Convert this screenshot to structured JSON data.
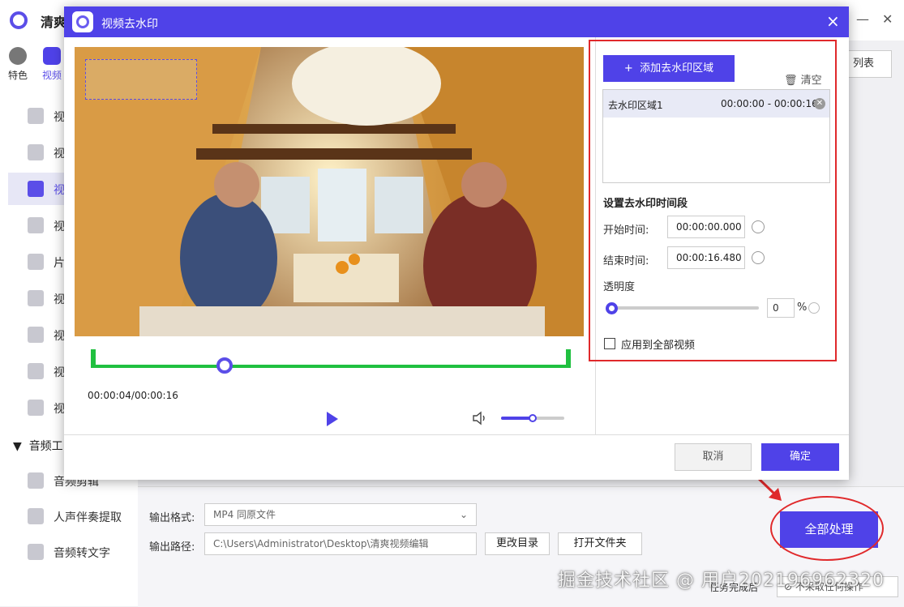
{
  "app": {
    "title": "清爽",
    "top_nav": [
      {
        "label": "特色"
      },
      {
        "label": "视频"
      }
    ],
    "sidebar_items": [
      {
        "label": "视"
      },
      {
        "label": "视"
      },
      {
        "label": "视"
      },
      {
        "label": "视"
      },
      {
        "label": "片"
      },
      {
        "label": "视"
      },
      {
        "label": "视"
      },
      {
        "label": "视"
      },
      {
        "label": "视"
      }
    ],
    "audio_section": "音频工",
    "audio_items": [
      {
        "label": "音频剪辑"
      },
      {
        "label": "人声伴奏提取"
      },
      {
        "label": "音频转文字"
      }
    ],
    "list_button": "列表",
    "output_format_label": "输出格式:",
    "output_format_value": "MP4  同原文件",
    "output_path_label": "输出路径:",
    "output_path_value": "C:\\Users\\Administrator\\Desktop\\清爽视频编辑",
    "change_dir_button": "更改目录",
    "open_folder_button": "打开文件夹",
    "process_all_button": "全部处理",
    "after_task_label": "任务完成后",
    "after_task_value": "不采取任何操作",
    "watermark_text": "掘金技术社区 @ 用户2021969623​20"
  },
  "dialog": {
    "title": "视频去水印",
    "time_display": "00:00:04/00:00:16",
    "add_region_button": "添加去水印区域",
    "clear_button": "清空",
    "regions": [
      {
        "name": "去水印区域1",
        "range": "00:00:00  - 00:00:16"
      }
    ],
    "time_section_title": "设置去水印时间段",
    "start_label": "开始时间:",
    "start_value": "00:00:00.000",
    "end_label": "结束时间:",
    "end_value": "00:00:16.480",
    "opacity_label": "透明度",
    "opacity_value": "0",
    "opacity_unit": "%",
    "apply_all_label": "应用到全部视频",
    "cancel_button": "取消",
    "ok_button": "确定",
    "playback_fraction": 0.25,
    "volume_fraction": 0.5
  },
  "colors": {
    "accent": "#4f42e8",
    "timeline": "#20c040",
    "annotation": "#e0292b"
  }
}
